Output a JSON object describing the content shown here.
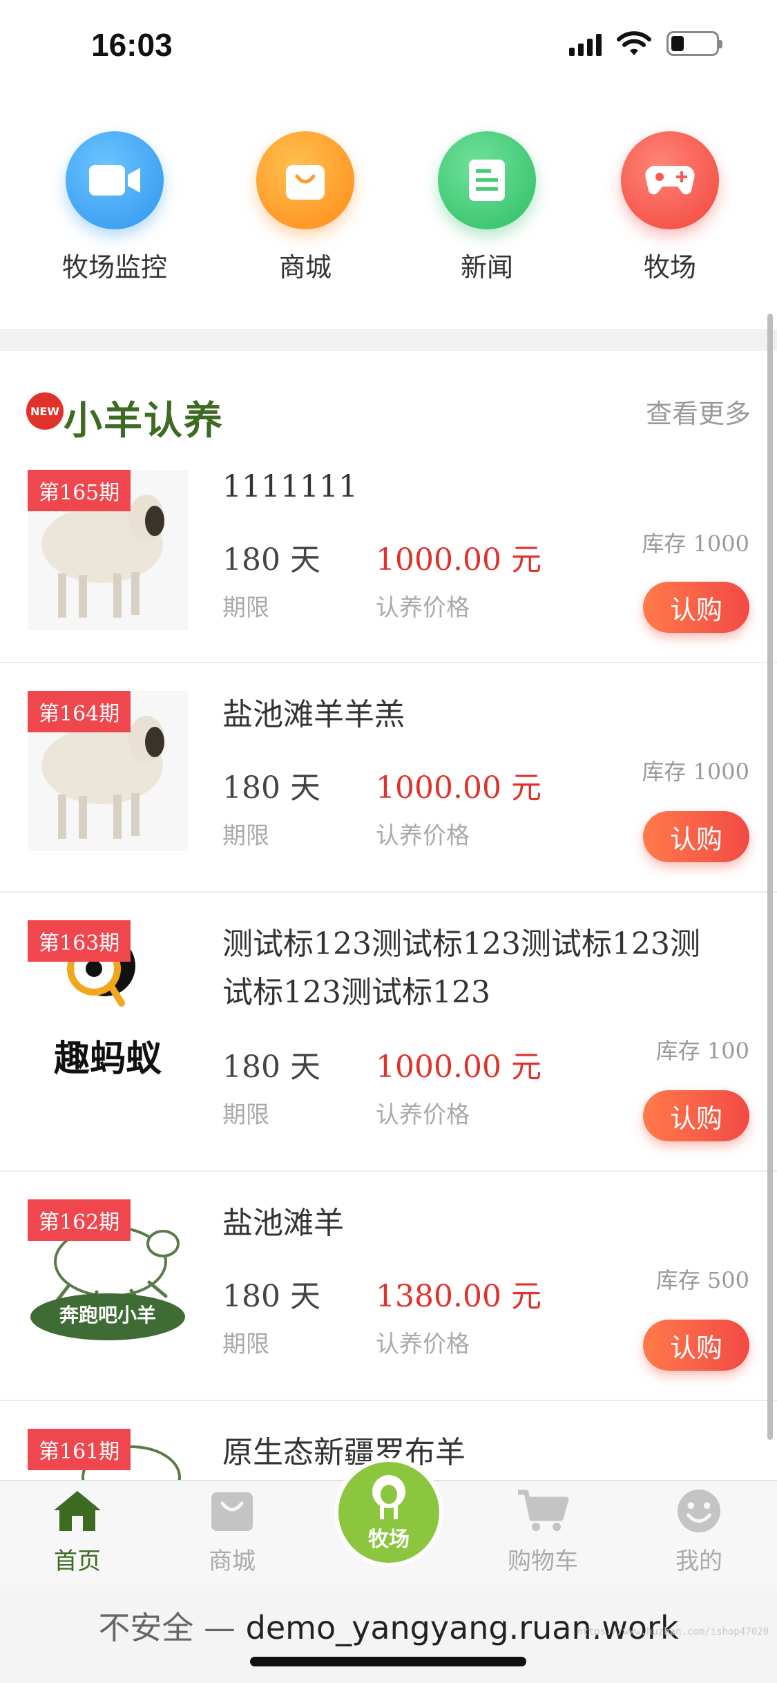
{
  "status_bar": {
    "time": "16:03"
  },
  "quick_nav": [
    {
      "label": "牧场监控",
      "icon": "video-camera-icon",
      "color": "#3fa8f5"
    },
    {
      "label": "商城",
      "icon": "shopping-bag-icon",
      "color": "#ff9a2e"
    },
    {
      "label": "新闻",
      "icon": "news-document-icon",
      "color": "#45cc79"
    },
    {
      "label": "牧场",
      "icon": "gamepad-icon",
      "color": "#f95a4e"
    }
  ],
  "section": {
    "badge": "NEW",
    "title": "小羊认养",
    "more": "查看更多"
  },
  "products": [
    {
      "tag": "第165期",
      "title": "1111111",
      "days": "180 天",
      "days_label": "期限",
      "price": "1000.00 元",
      "price_label": "认养价格",
      "stock": "库存 1000",
      "button": "认购",
      "image": "sheep"
    },
    {
      "tag": "第164期",
      "title": "盐池滩羊羊羔",
      "days": "180 天",
      "days_label": "期限",
      "price": "1000.00 元",
      "price_label": "认养价格",
      "stock": "库存 1000",
      "button": "认购",
      "image": "sheep"
    },
    {
      "tag": "第163期",
      "title": "测试标123测试标123测试标123测试标123测试标123",
      "days": "180 天",
      "days_label": "期限",
      "price": "1000.00 元",
      "price_label": "认养价格",
      "stock": "库存 100",
      "button": "认购",
      "image": "logo",
      "image_text": "趣蚂蚁"
    },
    {
      "tag": "第162期",
      "title": "盐池滩羊",
      "days": "180 天",
      "days_label": "期限",
      "price": "1380.00 元",
      "price_label": "认养价格",
      "stock": "库存 500",
      "button": "认购",
      "image": "running-sheep",
      "image_text": "奔跑吧小羊"
    },
    {
      "tag": "第161期",
      "title": "原生态新疆罗布羊"
    }
  ],
  "tab_bar": {
    "home": "首页",
    "shop": "商城",
    "center": "牧场",
    "cart": "购物车",
    "mine": "我的",
    "active_color": "#3c6b21"
  },
  "url_bar": {
    "insecure": "不安全 — ",
    "domain": "demo_yangyang.ruan.work",
    "watermark": "https://www.huzhan.com/ishop47020"
  }
}
